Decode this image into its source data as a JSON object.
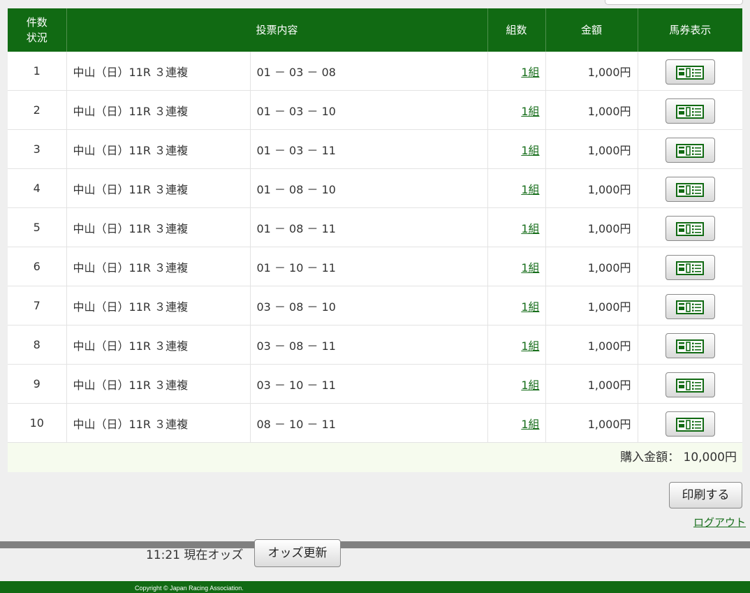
{
  "header": {
    "col_count_status": [
      "件数",
      "状況"
    ],
    "col_content": "投票内容",
    "col_kumi": "組数",
    "col_amount": "金額",
    "col_ticket": "馬券表示"
  },
  "rows": [
    {
      "no": "1",
      "race": "中山（日）11R ３連複",
      "combo": "01 － 03 － 08",
      "kumi": "1組",
      "amount": "1,000円"
    },
    {
      "no": "2",
      "race": "中山（日）11R ３連複",
      "combo": "01 － 03 － 10",
      "kumi": "1組",
      "amount": "1,000円"
    },
    {
      "no": "3",
      "race": "中山（日）11R ３連複",
      "combo": "01 － 03 － 11",
      "kumi": "1組",
      "amount": "1,000円"
    },
    {
      "no": "4",
      "race": "中山（日）11R ３連複",
      "combo": "01 － 08 － 10",
      "kumi": "1組",
      "amount": "1,000円"
    },
    {
      "no": "5",
      "race": "中山（日）11R ３連複",
      "combo": "01 － 08 － 11",
      "kumi": "1組",
      "amount": "1,000円"
    },
    {
      "no": "6",
      "race": "中山（日）11R ３連複",
      "combo": "01 － 10 － 11",
      "kumi": "1組",
      "amount": "1,000円"
    },
    {
      "no": "7",
      "race": "中山（日）11R ３連複",
      "combo": "03 － 08 － 10",
      "kumi": "1組",
      "amount": "1,000円"
    },
    {
      "no": "8",
      "race": "中山（日）11R ３連複",
      "combo": "03 － 08 － 11",
      "kumi": "1組",
      "amount": "1,000円"
    },
    {
      "no": "9",
      "race": "中山（日）11R ３連複",
      "combo": "03 － 10 － 11",
      "kumi": "1組",
      "amount": "1,000円"
    },
    {
      "no": "10",
      "race": "中山（日）11R ３連複",
      "combo": "08 － 10 － 11",
      "kumi": "1組",
      "amount": "1,000円"
    }
  ],
  "ticket_icon": "ticket-view-icon",
  "total": {
    "label": "購入金額：",
    "value": "10,000円"
  },
  "print_label": "印刷する",
  "logout_label": "ログアウト",
  "odds": {
    "time_text": "11:21 現在オッズ",
    "button_label": "オッズ更新"
  },
  "footer": {
    "copyright": "Copyright © Japan Racing Association."
  },
  "colors": {
    "header_green": "#116a13",
    "link_green": "#176e1b",
    "total_bg": "#f6fbee"
  }
}
